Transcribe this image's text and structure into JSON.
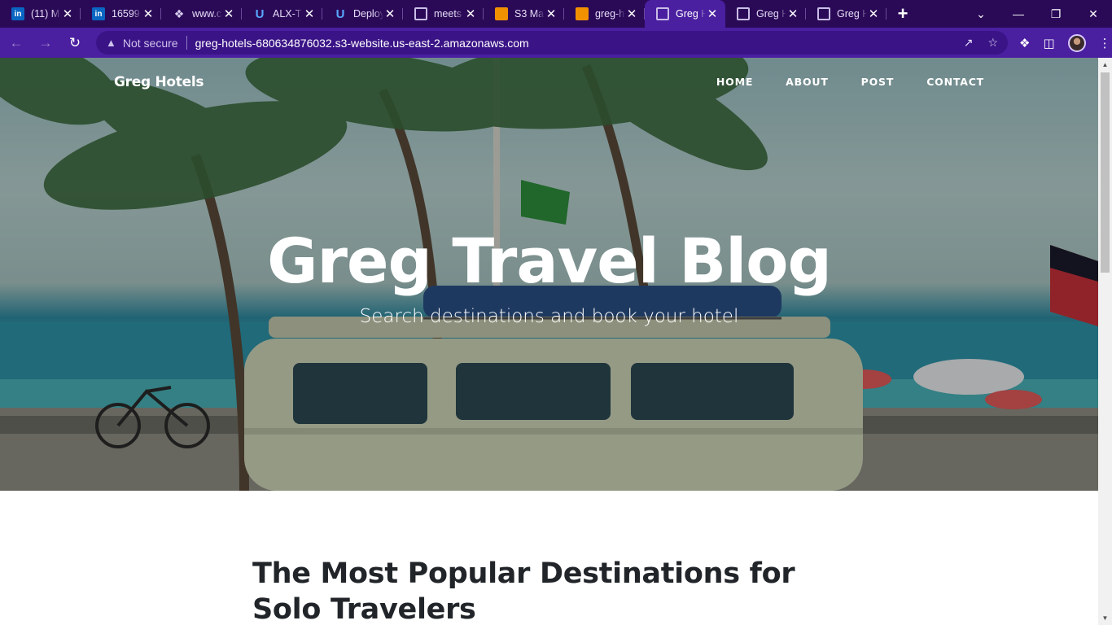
{
  "browser": {
    "tabs": [
      {
        "title": "(11) M",
        "favicon": "linkedin-icon",
        "active": false
      },
      {
        "title": "16599",
        "favicon": "linkedin-icon",
        "active": false
      },
      {
        "title": "www.c",
        "favicon": "link-icon",
        "active": false
      },
      {
        "title": "ALX-T",
        "favicon": "u-icon",
        "active": false
      },
      {
        "title": "Deploy",
        "favicon": "u-icon",
        "active": false
      },
      {
        "title": "meets",
        "favicon": "globe-icon",
        "active": false
      },
      {
        "title": "S3 Ma",
        "favicon": "aws-icon",
        "active": false
      },
      {
        "title": "greg-h",
        "favicon": "aws-icon",
        "active": false
      },
      {
        "title": "Greg H",
        "favicon": "globe-icon",
        "active": true
      },
      {
        "title": "Greg H",
        "favicon": "globe-icon",
        "active": false
      },
      {
        "title": "Greg H",
        "favicon": "globe-icon",
        "active": false
      }
    ],
    "security_label": "Not secure",
    "url": "greg-hotels-680634876032.s3-website.us-east-2.amazonaws.com",
    "colors": {
      "tabstrip": "#2a0a57",
      "toolbar": "#4a1fa0",
      "omnibox": "#3a1487"
    }
  },
  "site": {
    "brand": "Greg Hotels",
    "nav": {
      "home": "HOME",
      "about": "ABOUT",
      "post": "POST",
      "contact": "CONTACT"
    },
    "hero": {
      "title": "Greg Travel Blog",
      "subtitle": "Search destinations and book your hotel"
    },
    "post_title": "The Most Popular Destinations for Solo Travelers"
  }
}
